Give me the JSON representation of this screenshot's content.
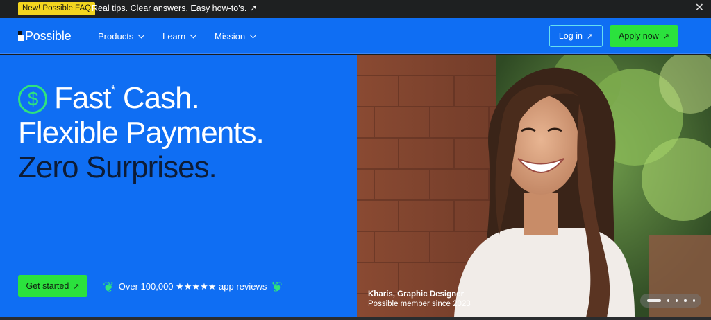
{
  "announcement": {
    "badge": "New! Possible FAQ",
    "message": "Real tips. Clear answers. Easy how-to's.",
    "arrow": "↗",
    "close": "✕"
  },
  "nav": {
    "logo_text": "Possible",
    "items": [
      {
        "label": "Products"
      },
      {
        "label": "Learn"
      },
      {
        "label": "Mission"
      }
    ],
    "login_label": "Log in",
    "apply_label": "Apply now",
    "arrow": "↗"
  },
  "hero": {
    "dollar_icon": "$",
    "line1": "Fast",
    "line1_sup": "*",
    "line1_rest": " Cash.",
    "line2": "Flexible Payments.",
    "line3": "Zero Surprises.",
    "cta_label": "Get started",
    "cta_arrow": "↗",
    "reviews_text": "Over 100,000 ★★★★★ app reviews",
    "laurel_left": "❦",
    "laurel_right": "❦"
  },
  "photo": {
    "caption_name": "Kharis, Graphic Designer",
    "caption_sub": "Possible member since 2023"
  },
  "colors": {
    "brand_blue": "#0f6ef3",
    "cta_green": "#2be23d",
    "badge_yellow": "#f3d51f",
    "accent_green": "#2fe37d",
    "headline_dark": "#0d1c36"
  }
}
